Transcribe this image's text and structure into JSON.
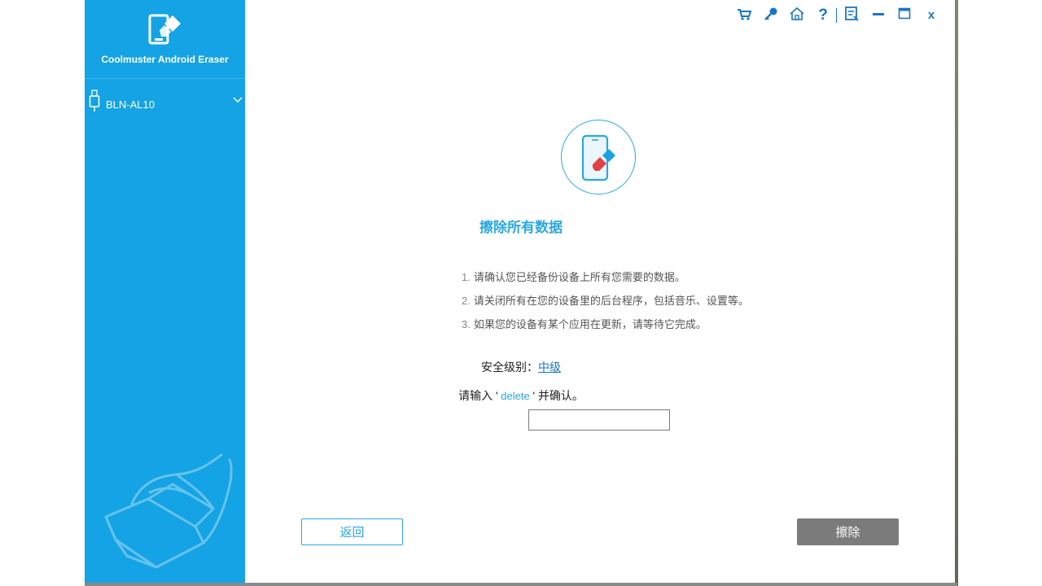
{
  "app": {
    "name": "Coolmuster Android Eraser"
  },
  "sidebar": {
    "device_name": "BLN-AL10"
  },
  "toolbar": {
    "icons": [
      "cart-icon",
      "key-icon",
      "home-icon",
      "help-icon",
      "feedback-icon",
      "minimize-icon",
      "maximize-icon",
      "close-icon"
    ]
  },
  "main": {
    "title": "擦除所有数据",
    "steps": [
      {
        "num": "1.",
        "text": "请确认您已经备份设备上所有您需要的数据。"
      },
      {
        "num": "2.",
        "text": "请关闭所有在您的设备里的后台程序，包括音乐、设置等。"
      },
      {
        "num": "3.",
        "text": "如果您的设备有某个应用在更新，请等待它完成。"
      }
    ],
    "security_label": "安全级别：",
    "security_value": "中级",
    "confirm_prefix": "请输入 '",
    "confirm_keyword": " delete ",
    "confirm_suffix": "' 并确认。",
    "confirm_input_value": "",
    "back_label": "返回",
    "erase_label": "擦除"
  },
  "colors": {
    "sidebar": "#14a3e4",
    "accent": "#2aa7e0",
    "link": "#1976c5",
    "erase_button": "#7b7b7b"
  }
}
